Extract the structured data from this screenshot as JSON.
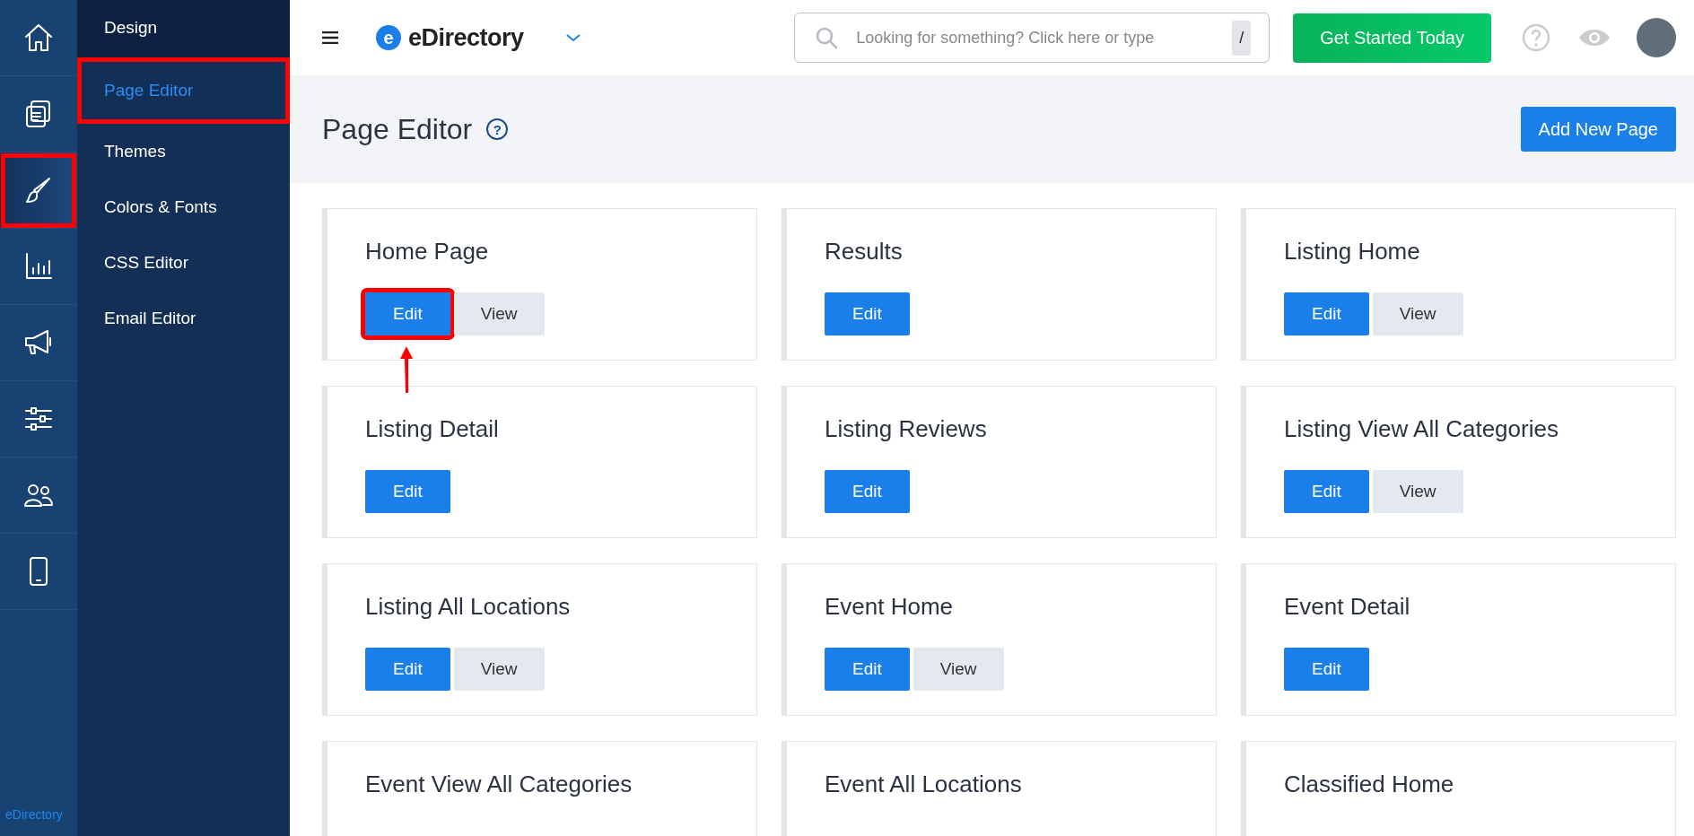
{
  "rail": {
    "items": [
      {
        "kind": "home",
        "selected": false,
        "highlighted": false
      },
      {
        "kind": "documents",
        "selected": false,
        "highlighted": false
      },
      {
        "kind": "brush",
        "selected": true,
        "highlighted": true
      },
      {
        "kind": "chart",
        "selected": false,
        "highlighted": false
      },
      {
        "kind": "megaphone",
        "selected": false,
        "highlighted": false
      },
      {
        "kind": "sliders",
        "selected": false,
        "highlighted": false
      },
      {
        "kind": "users",
        "selected": false,
        "highlighted": false
      },
      {
        "kind": "phone",
        "selected": false,
        "highlighted": false
      }
    ],
    "footer": "eDirectory"
  },
  "submenu": {
    "title": "Design",
    "items": [
      {
        "label": "Page Editor",
        "selected": true,
        "highlighted": true
      },
      {
        "label": "Themes",
        "selected": false,
        "highlighted": false
      },
      {
        "label": "Colors & Fonts",
        "selected": false,
        "highlighted": false
      },
      {
        "label": "CSS Editor",
        "selected": false,
        "highlighted": false
      },
      {
        "label": "Email Editor",
        "selected": false,
        "highlighted": false
      }
    ]
  },
  "topbar": {
    "brand": "eDirectory",
    "brand_badge": "e",
    "search": {
      "placeholder": "Looking for something? Click here or type",
      "shortcut": "/"
    },
    "cta": "Get Started Today"
  },
  "header": {
    "title": "Page Editor",
    "help": "?",
    "add_button": "Add New Page"
  },
  "cards": [
    {
      "title": "Home Page",
      "buttons": [
        {
          "kind": "edit",
          "label": "Edit",
          "highlighted": true
        },
        {
          "kind": "view",
          "label": "View",
          "highlighted": false
        }
      ]
    },
    {
      "title": "Results",
      "buttons": [
        {
          "kind": "edit",
          "label": "Edit",
          "highlighted": false
        }
      ]
    },
    {
      "title": "Listing Home",
      "buttons": [
        {
          "kind": "edit",
          "label": "Edit",
          "highlighted": false
        },
        {
          "kind": "view",
          "label": "View",
          "highlighted": false
        }
      ]
    },
    {
      "title": "Listing Detail",
      "buttons": [
        {
          "kind": "edit",
          "label": "Edit",
          "highlighted": false
        }
      ]
    },
    {
      "title": "Listing Reviews",
      "buttons": [
        {
          "kind": "edit",
          "label": "Edit",
          "highlighted": false
        }
      ]
    },
    {
      "title": "Listing View All Categories",
      "buttons": [
        {
          "kind": "edit",
          "label": "Edit",
          "highlighted": false
        },
        {
          "kind": "view",
          "label": "View",
          "highlighted": false
        }
      ]
    },
    {
      "title": "Listing All Locations",
      "buttons": [
        {
          "kind": "edit",
          "label": "Edit",
          "highlighted": false
        },
        {
          "kind": "view",
          "label": "View",
          "highlighted": false
        }
      ]
    },
    {
      "title": "Event Home",
      "buttons": [
        {
          "kind": "edit",
          "label": "Edit",
          "highlighted": false
        },
        {
          "kind": "view",
          "label": "View",
          "highlighted": false
        }
      ]
    },
    {
      "title": "Event Detail",
      "buttons": [
        {
          "kind": "edit",
          "label": "Edit",
          "highlighted": false
        }
      ]
    },
    {
      "title": "Event View All Categories"
    },
    {
      "title": "Event All Locations"
    },
    {
      "title": "Classified Home"
    }
  ]
}
